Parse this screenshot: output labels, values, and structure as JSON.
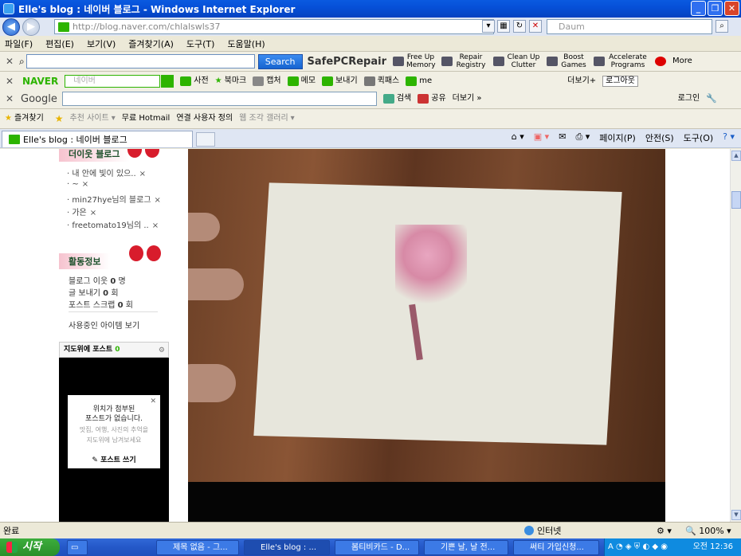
{
  "window": {
    "title": "Elle's blog : 네이버 블로그 - Windows Internet Explorer"
  },
  "address": {
    "url": "http://blog.naver.com/chlalswls37",
    "search_placeholder": "Daum"
  },
  "menu": [
    "파일(F)",
    "편집(E)",
    "보기(V)",
    "즐겨찾기(A)",
    "도구(T)",
    "도움말(H)"
  ],
  "ask_toolbar": {
    "search_label": "Search",
    "brand": "SafePCRepair",
    "items": [
      "Free Up Memory",
      "Repair Registry",
      "Clean Up Clutter",
      "Boost Games",
      "Accelerate Programs"
    ],
    "more": "More"
  },
  "naver_toolbar": {
    "logo": "NAVER",
    "placeholder": "네이버",
    "items": [
      "사전",
      "북마크",
      "캡처",
      "메모",
      "보내기",
      "퀵패스",
      "me"
    ],
    "more": "더보기+",
    "logout": "로그아웃"
  },
  "google_toolbar": {
    "logo": "Google",
    "search": "검색",
    "share": "공유",
    "more": "더보기 »",
    "login": "로그인"
  },
  "favorites": {
    "label": "즐겨찾기",
    "items": [
      "추천 사이트",
      "무료 Hotmail",
      "연결 사용자 정의",
      "웹 조각 갤러리"
    ]
  },
  "tab": {
    "title": "Elle's blog : 네이버 블로그"
  },
  "command_bar": [
    "페이지(P)",
    "안전(S)",
    "도구(O)"
  ],
  "sidebar": {
    "neighbors_title": "더이웃 블로그",
    "neighbors": [
      "내 안에 빛이 있으..",
      "~",
      "min27hye님의 블로그",
      "가은",
      "freetomato19님의 .."
    ],
    "activity_title": "활동정보",
    "stats": [
      {
        "label": "블로그 이웃",
        "value": "0",
        "unit": "명"
      },
      {
        "label": "글 보내기",
        "value": "0",
        "unit": "회"
      },
      {
        "label": "포스트 스크랩",
        "value": "0",
        "unit": "회"
      }
    ],
    "items_link": "사용중인 아이템 보기",
    "map": {
      "title": "지도위에 포스트",
      "count": "0",
      "popup_line1": "위치가 첨부된",
      "popup_line2": "포스트가 없습니다.",
      "popup_sub1": "맛집, 여행, 사진의 추억을",
      "popup_sub2": "지도위에 남겨보세요",
      "write": "포스트 쓰기"
    }
  },
  "status": {
    "left": "완료",
    "zone": "인터넷",
    "zoom": "100%"
  },
  "taskbar": {
    "start": "시작",
    "tasks": [
      "제목 없음 - 그...",
      "Elle's blog : ...",
      "봄티비카드 - D...",
      "기쁜 날, 날 전...",
      "써티 가입신청..."
    ],
    "clock": "오전 12:36"
  }
}
